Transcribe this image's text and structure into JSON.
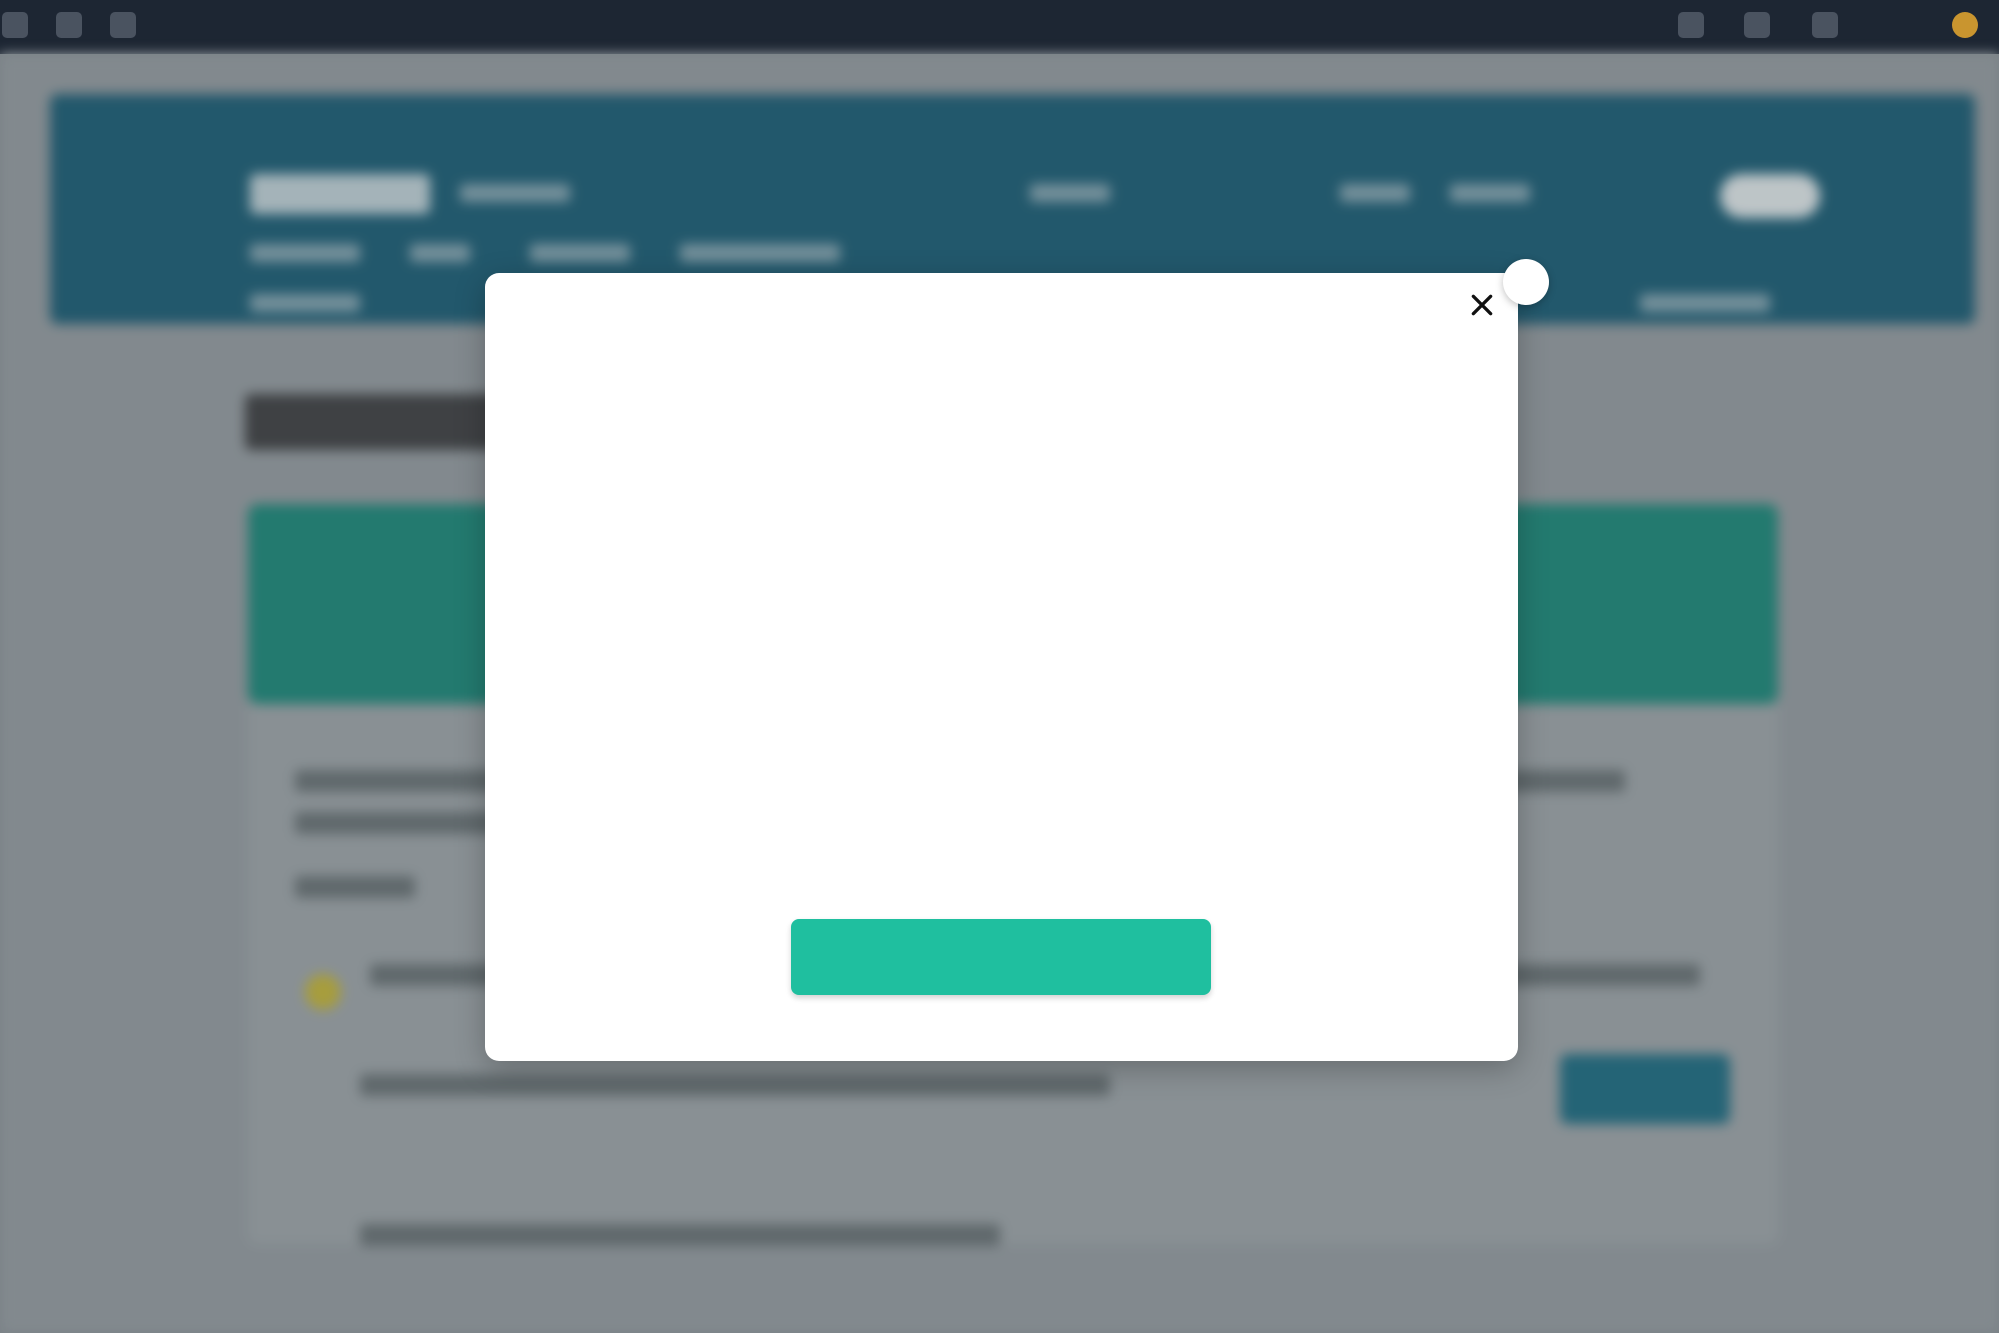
{
  "browser": {
    "tab_title": ""
  },
  "modal": {
    "close_icon": "close-icon",
    "cta_label": ""
  },
  "colors": {
    "modal_bg": "#ffffff",
    "cta": "#1fbf9f",
    "header": "#1a5f78",
    "topbar": "#1d2633"
  }
}
